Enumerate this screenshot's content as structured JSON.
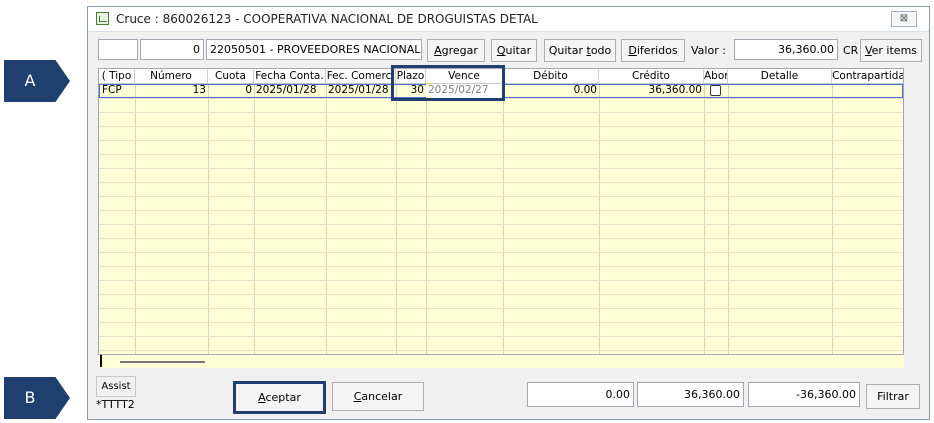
{
  "callouts": {
    "a": "A",
    "b": "B"
  },
  "window": {
    "title": "Cruce : 860026123 - COOPERATIVA NACIONAL DE DROGUISTAS DETAL",
    "close_glyph": "⊠"
  },
  "toolbar": {
    "field_blank": "",
    "field_count": "0",
    "field_account": "22050501 - PROVEEDORES NACIONAL",
    "agregar": {
      "u": "A",
      "rest": "gregar"
    },
    "quitar": {
      "u": "Q",
      "rest": "uitar"
    },
    "quitar_todo": {
      "pre": "Quitar ",
      "u": "t",
      "rest": "odo"
    },
    "diferidos": {
      "u": "D",
      "rest": "iferidos"
    },
    "valor_label": "Valor :",
    "valor_value": "36,360.00",
    "cr_label": "CR",
    "ver_items": {
      "u": "V",
      "rest": "er items"
    }
  },
  "grid": {
    "columns": [
      {
        "key": "tipo",
        "label": "( Tipo"
      },
      {
        "key": "numero",
        "label": "Número"
      },
      {
        "key": "cuota",
        "label": "Cuota"
      },
      {
        "key": "fecha_conta",
        "label": "Fecha Conta."
      },
      {
        "key": "fec_comerc",
        "label": "Fec. Comerci"
      },
      {
        "key": "plazo",
        "label": "Plazo"
      },
      {
        "key": "vence",
        "label": "Vence"
      },
      {
        "key": "debito",
        "label": "Débito"
      },
      {
        "key": "credito",
        "label": "Crédito"
      },
      {
        "key": "abono",
        "label": "Abor"
      },
      {
        "key": "detalle",
        "label": "Detalle"
      },
      {
        "key": "contrapartida",
        "label": "Contrapartida"
      }
    ],
    "rows": [
      {
        "tipo": "FCP",
        "numero": "13",
        "cuota": "0",
        "fecha_conta": "2025/01/28",
        "fec_comerc": "2025/01/28",
        "plazo": "30",
        "vence": "2025/02/27",
        "debito": "0.00",
        "credito": "36,360.00",
        "abono": false,
        "detalle": "",
        "contrapartida": ""
      }
    ]
  },
  "footer": {
    "assist": "Assist",
    "code": "*TTTT2",
    "aceptar": {
      "u": "A",
      "rest": "ceptar"
    },
    "cancelar": {
      "u": "C",
      "rest": "ancelar"
    },
    "total_debito": "0.00",
    "total_credito": "36,360.00",
    "diferencia": "-36,360.00",
    "filtrar": "Filtrar"
  },
  "colors": {
    "grid_bg": "#fffed6",
    "callout": "#1f3f6e",
    "selection": "#4a6fd0"
  }
}
